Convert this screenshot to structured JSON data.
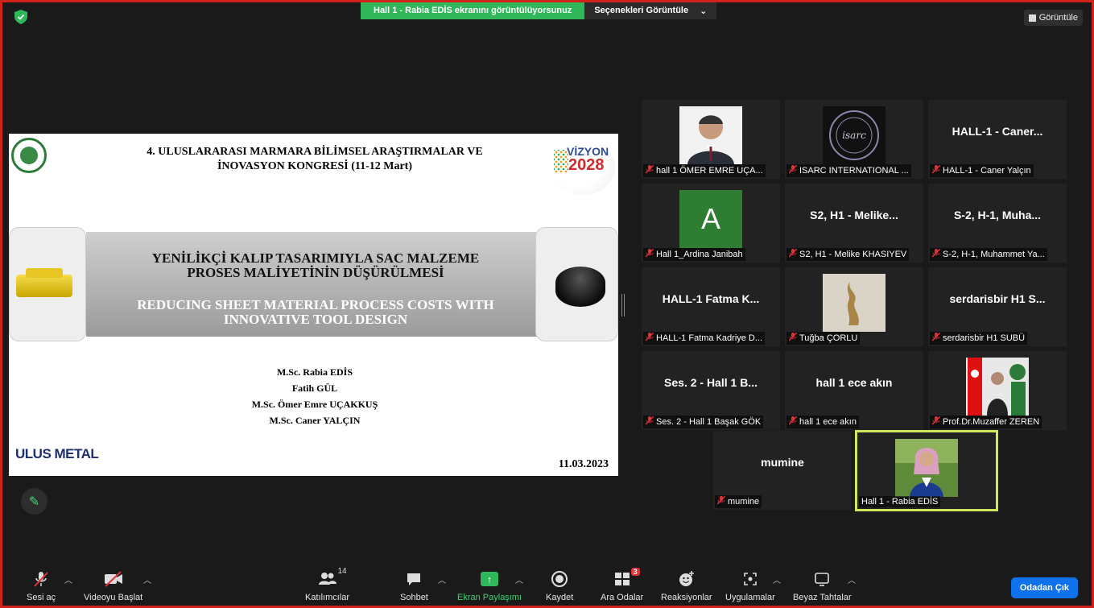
{
  "banner": {
    "sharing_text": "Hall 1 - Rabia EDİS ekranını görüntülüyorsunuz",
    "options_label": "Seçenekleri Görüntüle",
    "options_caret": "⌄"
  },
  "view_button": {
    "label": "Görüntüle"
  },
  "slide": {
    "conference_line1": "4. ULUSLARARASI MARMARA BİLİMSEL ARAŞTIRMALAR VE",
    "conference_line2": "İNOVASYON KONGRESİ (11-12 Mart)",
    "vizyon_word": "VİZYON",
    "vizyon_year": "2028",
    "title_tr_line1": "YENİLİKÇİ KALIP TASARIMIYLA SAC MALZEME",
    "title_tr_line2": "PROSES MALİYETİNİN DÜŞÜRÜLMESİ",
    "title_en_line1": "REDUCING SHEET MATERIAL PROCESS COSTS WITH",
    "title_en_line2": "INNOVATIVE TOOL DESIGN",
    "authors": [
      "M.Sc. Rabia EDİS",
      "Fatih GÜL",
      "M.Sc. Ömer Emre UÇAKKUŞ",
      "M.Sc. Caner YALÇIN"
    ],
    "company": "ULUS METAL",
    "date": "11.03.2023"
  },
  "participants": [
    {
      "display": "",
      "caption": "hall 1 ÖMER EMRE UÇA...",
      "muted": true,
      "kind": "photo-man"
    },
    {
      "display": "",
      "caption": "ISARC INTERNATIONAL ...",
      "muted": true,
      "kind": "logo-isarc"
    },
    {
      "display": "HALL-1 - Caner...",
      "caption": "HALL-1 - Caner Yalçın",
      "muted": true,
      "kind": "name"
    },
    {
      "display": "A",
      "caption": "Hall 1_Ardina Janibah",
      "muted": true,
      "kind": "avatar"
    },
    {
      "display": "S2, H1 - Melike...",
      "caption": "S2, H1 - Melike KHASIYEV",
      "muted": true,
      "kind": "name"
    },
    {
      "display": "S-2, H-1, Muha...",
      "caption": "S-2, H-1, Muhammet Ya...",
      "muted": true,
      "kind": "name"
    },
    {
      "display": "HALL-1 Fatma K...",
      "caption": "HALL-1 Fatma Kadriye D...",
      "muted": true,
      "kind": "name"
    },
    {
      "display": "",
      "caption": "Tuğba ÇORLU",
      "muted": true,
      "kind": "photo-statue"
    },
    {
      "display": "serdarisbir H1 S...",
      "caption": "serdarisbir H1 SUBÜ",
      "muted": true,
      "kind": "name"
    },
    {
      "display": "Ses. 2 - Hall 1 B...",
      "caption": "Ses. 2 - Hall 1 Başak GÖK",
      "muted": true,
      "kind": "name"
    },
    {
      "display": "hall 1 ece akın",
      "caption": "hall 1 ece akın",
      "muted": true,
      "kind": "name"
    },
    {
      "display": "",
      "caption": "Prof.Dr.Muzaffer ZEREN",
      "muted": true,
      "kind": "photo-flag"
    },
    {
      "display": "mumine",
      "caption": "mumine",
      "muted": true,
      "kind": "name"
    },
    {
      "display": "",
      "caption": "Hall 1 - Rabia EDİS",
      "muted": false,
      "kind": "photo-woman"
    }
  ],
  "toolbar": {
    "mute_label": "Sesi aç",
    "video_label": "Videoyu Başlat",
    "participants_label": "Katılımcılar",
    "participants_count": "14",
    "chat_label": "Sohbet",
    "share_label": "Ekran Paylaşımı",
    "record_label": "Kaydet",
    "breakout_label": "Ara Odalar",
    "breakout_badge": "3",
    "reactions_label": "Reaksiyonlar",
    "apps_label": "Uygulamalar",
    "whiteboard_label": "Beyaz Tahtalar",
    "leave_label": "Odadan Çık"
  },
  "colors": {
    "accent_green": "#2fb75a",
    "leave_blue": "#0e72ed",
    "frame_red": "#d0211c",
    "active_speaker": "#cfe75a",
    "muted_red": "#e0313b"
  }
}
